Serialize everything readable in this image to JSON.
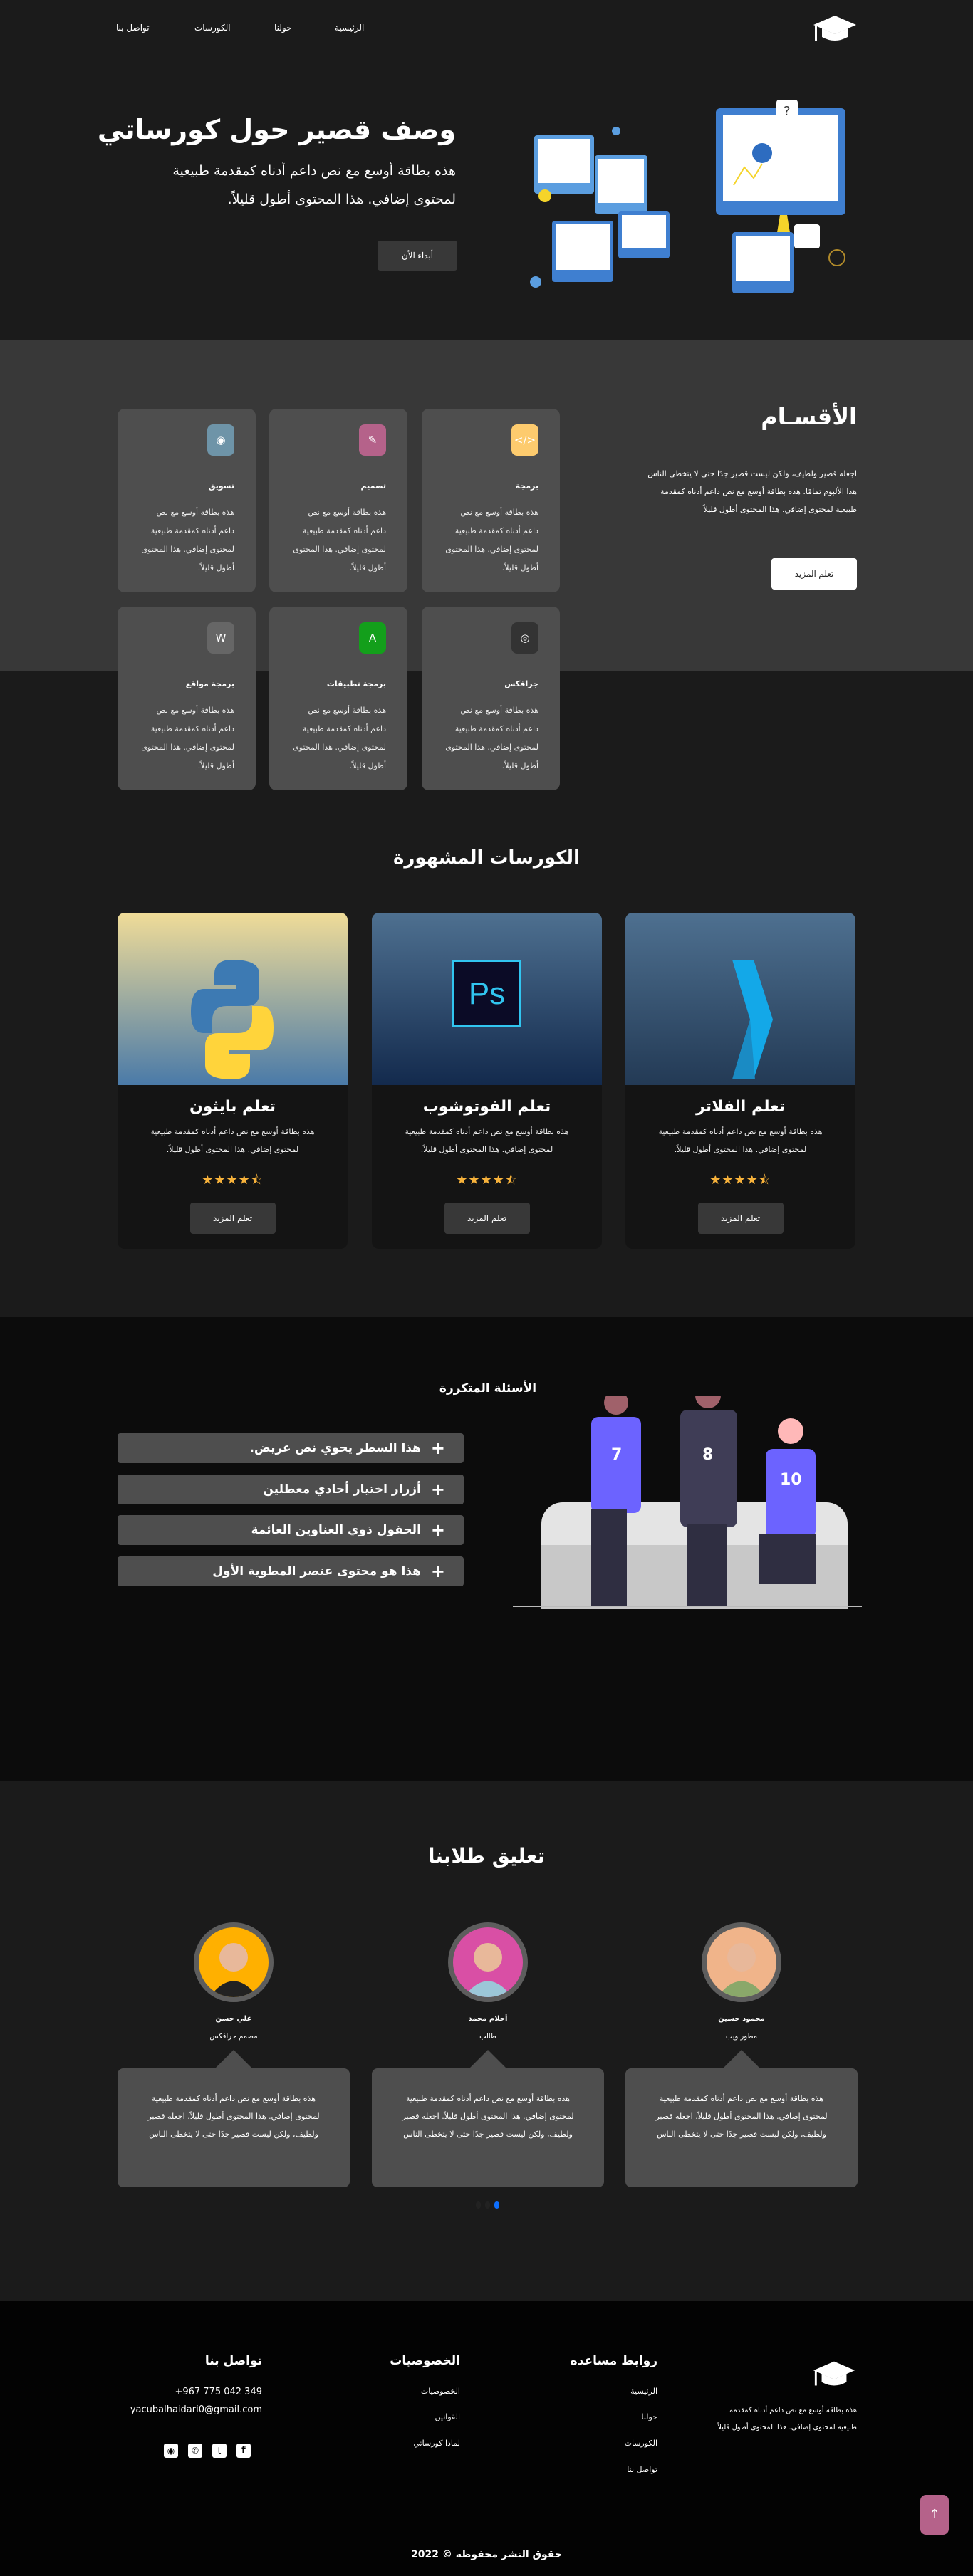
{
  "nav": {
    "items": [
      "الرئيسية",
      "حولنا",
      "الكورسات",
      "تواصل بنا"
    ]
  },
  "hero": {
    "title": "وصف قصير حول كورساتي",
    "text": "هذه بطاقة أوسع مع نص داعم أدناه كمقدمة طبيعية لمحتوى إضافي. هذا المحتوى أطول قليلاً.",
    "button": "أبداء الأن"
  },
  "categories": {
    "title": "الأقسـام",
    "text": "اجعله قصير ولطيف، ولكن ليست قصير جدًا حتى لا يتخطى الناس هذا الألبوم تمامًا. هذه بطاقة أوسع مع نص داعم أدناه كمقدمة طبيعية لمحتوى إضافي. هذا المحتوى أطول قليلاً",
    "button": "تعلم المزيد",
    "card_text": "هذه بطاقة أوسع مع نص داعم أدناه كمقدمة طبيعية لمحتوى إضافي. هذا المحتوى أطول قليلاً.",
    "items": [
      {
        "title": "برمجة",
        "icon": "code-icon",
        "color": "#fdcb6e"
      },
      {
        "title": "تصميم",
        "icon": "pen-icon",
        "color": "#b5628a"
      },
      {
        "title": "تسويق",
        "icon": "marketing-icon",
        "color": "#6e94a8"
      },
      {
        "title": "جرافكس",
        "icon": "eye-icon",
        "color": "#333333"
      },
      {
        "title": "برمجة تطبيقات",
        "icon": "app-store-icon",
        "color": "#139f1b"
      },
      {
        "title": "برمجة مواقع",
        "icon": "wordpress-icon",
        "color": "#666666"
      }
    ]
  },
  "courses": {
    "title": "الكورسات المشهورة",
    "items": [
      {
        "title": "تعلم الفلاتر",
        "text": "هذه بطاقة أوسع مع نص داعم أدناه كمقدمة طبيعية لمحتوى إضافي. هذا المحتوى أطول قليلاً.",
        "rating": 4.5,
        "button": "تعلم المزيد"
      },
      {
        "title": "تعلم الفوتوشوب",
        "text": "هذه بطاقة أوسع مع نص داعم أدناه كمقدمة طبيعية لمحتوى إضافي. هذا المحتوى أطول قليلاً.",
        "rating": 4.5,
        "button": "تعلم المزيد"
      },
      {
        "title": "تعلم بايثون",
        "text": "هذه بطاقة أوسع مع نص داعم أدناه كمقدمة طبيعية لمحتوى إضافي. هذا المحتوى أطول قليلاً.",
        "rating": 4.5,
        "button": "تعلم المزيد"
      }
    ],
    "logo_text": "Ps"
  },
  "faq": {
    "title": "الأسئلة المتكررة",
    "items": [
      "هذا السطر يحوي نص عريض.",
      "أزرار اختيار أحادي معطلين",
      "الحقول ذوي العناوين العائمة",
      "هذا هو محتوى عنصر المطوية الأول"
    ],
    "jerseys": [
      "7",
      "8",
      "10"
    ]
  },
  "testimonials": {
    "title": "تعليق طلابنا",
    "text": "هذه بطاقة أوسع مع نص داعم أدناه كمقدمة طبيعية لمحتوى إضافي. هذا المحتوى أطول قليلاً. اجعله قصير ولطيف، ولكن ليست قصير جدًا حتى لا يتخطى الناس",
    "items": [
      {
        "name": "محمود حسين",
        "role": "مطور ويب",
        "color": "#f0b48a"
      },
      {
        "name": "أحلام محمد",
        "role": "طالب",
        "color": "#d94fa5"
      },
      {
        "name": "علي حسن",
        "role": "مصمم جرافكس",
        "color": "#ffb000"
      }
    ],
    "active_slide": 3,
    "slide_count": 3
  },
  "footer": {
    "about": "هذه بطاقة أوسع مع نص داعم أدناه كمقدمة طبيعية لمحتوى إضافي. هذا المحتوى أطول قليلاً",
    "links_title": "روابط مساعده",
    "links": [
      "الرئيسية",
      "حولنا",
      "الكورسات",
      "تواصل بنا"
    ],
    "privacy_title": "الخصوصيات",
    "privacy": [
      "الخصوصيات",
      "القوانين",
      "لماذا كورساتي"
    ],
    "contact_title": "تواصل بنا",
    "phone": "+967 775 042 349",
    "email": "yacubalhaidari0@gmail.com",
    "social": [
      "facebook-icon",
      "twitter-icon",
      "whatsapp-icon",
      "github-icon"
    ],
    "copyright": "حقوق النشر محفوظة © 2022"
  }
}
